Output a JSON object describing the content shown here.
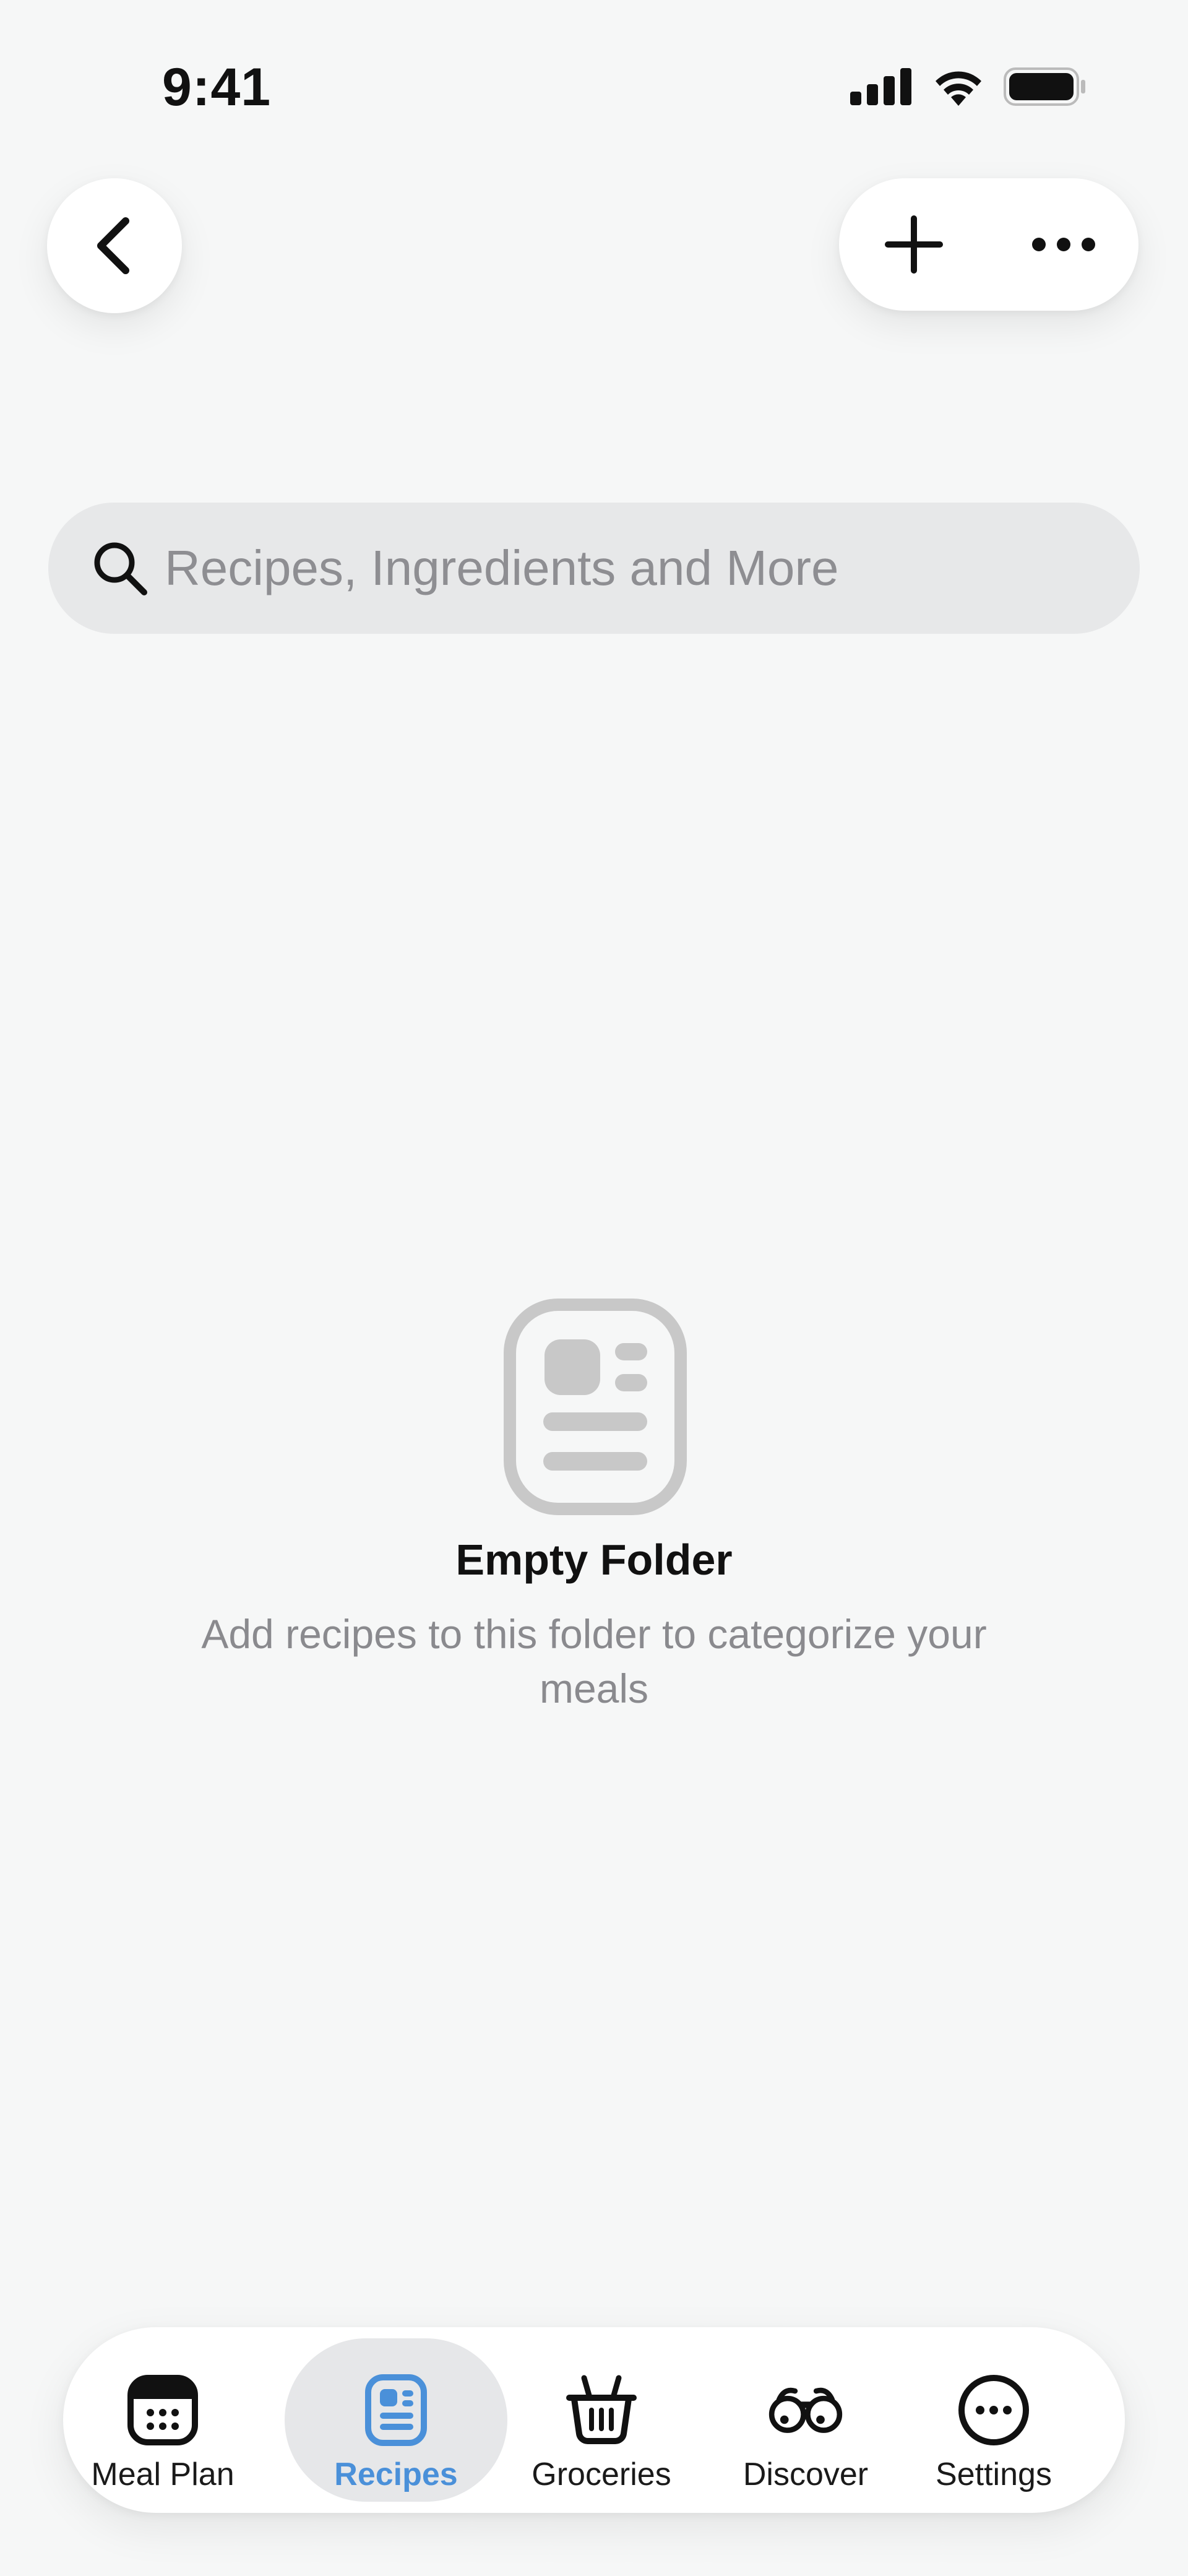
{
  "status_bar": {
    "time": "9:41"
  },
  "header": {
    "back_icon": "chevron-left-icon",
    "add_icon": "plus-icon",
    "more_icon": "ellipsis-icon"
  },
  "search": {
    "placeholder": "Recipes, Ingredients and More",
    "icon": "magnifier-icon"
  },
  "empty_state": {
    "icon": "recipe-card-icon",
    "title": "Empty Folder",
    "description": "Add recipes to this folder to categorize your meals"
  },
  "tab_bar": {
    "active_color": "#4a90d9",
    "tabs": [
      {
        "label": "Meal Plan",
        "icon": "calendar-icon",
        "active": false
      },
      {
        "label": "Recipes",
        "icon": "recipe-card-icon",
        "active": true
      },
      {
        "label": "Groceries",
        "icon": "basket-icon",
        "active": false
      },
      {
        "label": "Discover",
        "icon": "binoculars-icon",
        "active": false
      },
      {
        "label": "Settings",
        "icon": "more-circle-icon",
        "active": false
      }
    ]
  }
}
